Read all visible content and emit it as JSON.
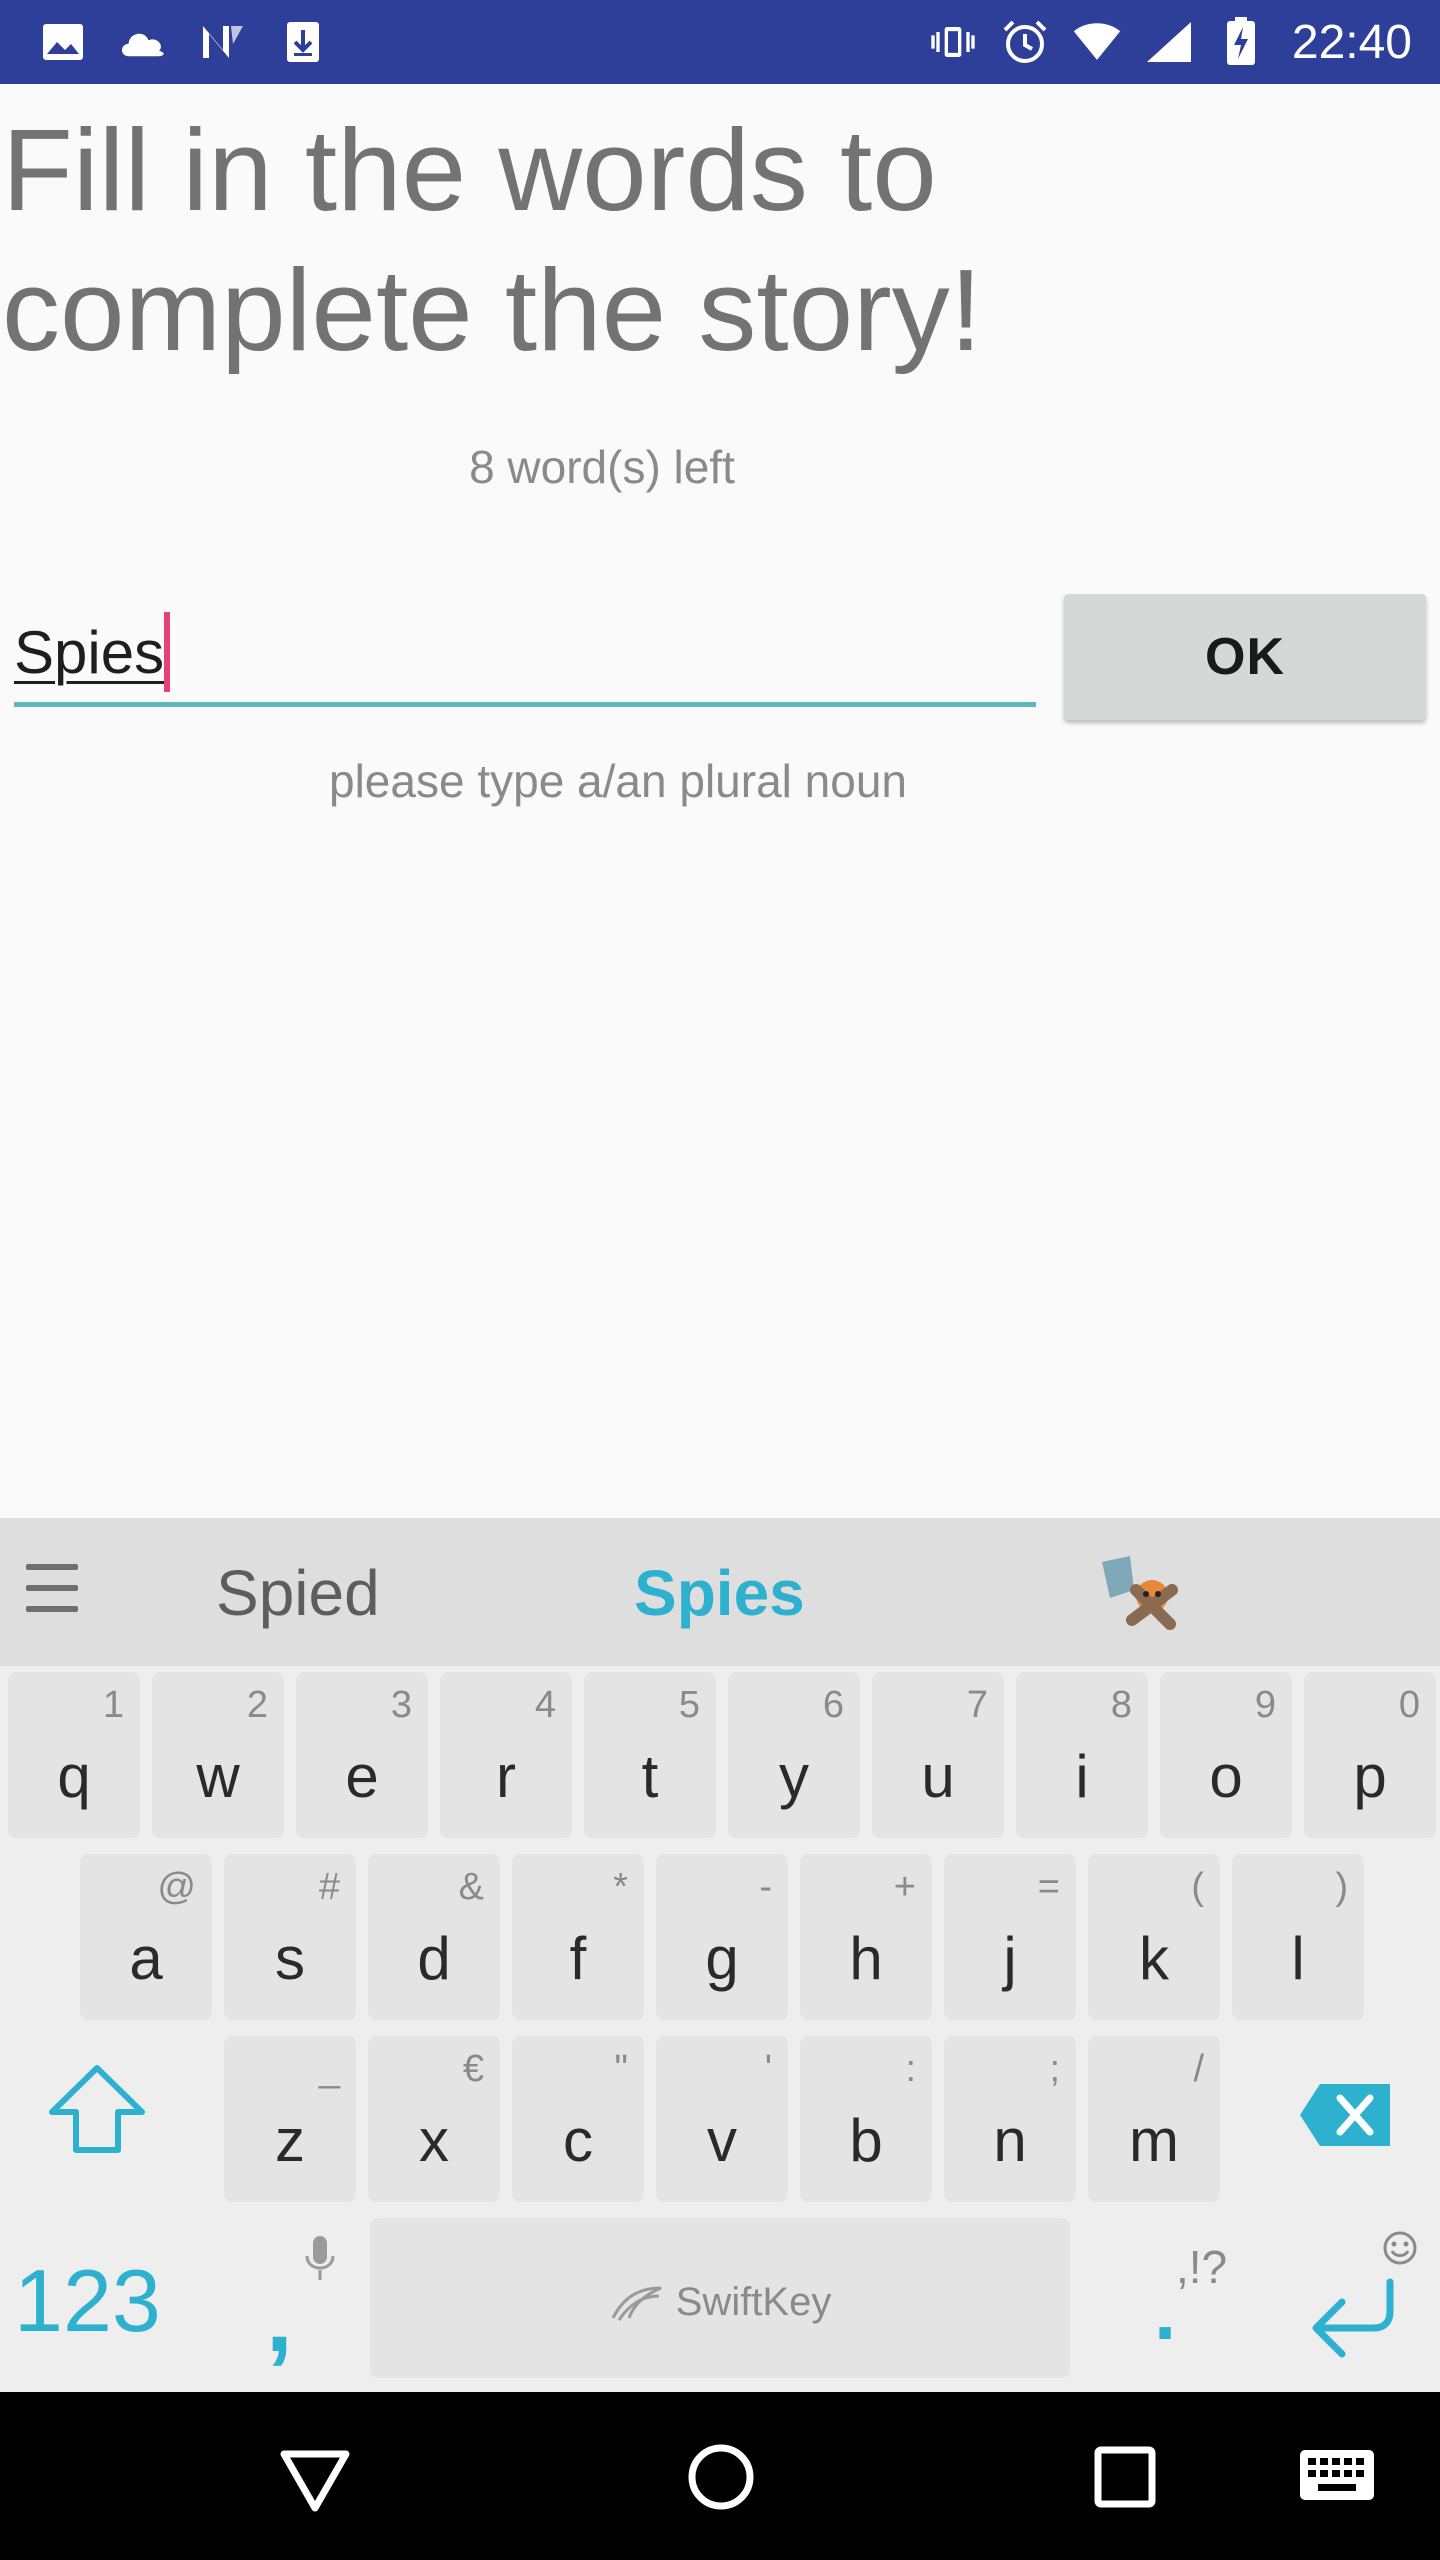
{
  "status_bar": {
    "time": "22:40",
    "left_icons": [
      "image-icon",
      "cloud-icon",
      "n-logo-icon",
      "download-icon"
    ],
    "right_icons": [
      "vibrate-icon",
      "alarm-icon",
      "wifi-icon",
      "signal-icon",
      "battery-charging-icon"
    ]
  },
  "app": {
    "title": "Fill in the words to complete the story!",
    "words_left": "8 word(s) left",
    "input_value": "Spies",
    "ok_label": "OK",
    "hint": "please type a/an plural noun"
  },
  "keyboard": {
    "suggestions": [
      "Spied",
      "Spies"
    ],
    "row1": [
      {
        "letter": "q",
        "hint": "1"
      },
      {
        "letter": "w",
        "hint": "2"
      },
      {
        "letter": "e",
        "hint": "3"
      },
      {
        "letter": "r",
        "hint": "4"
      },
      {
        "letter": "t",
        "hint": "5"
      },
      {
        "letter": "y",
        "hint": "6"
      },
      {
        "letter": "u",
        "hint": "7"
      },
      {
        "letter": "i",
        "hint": "8"
      },
      {
        "letter": "o",
        "hint": "9"
      },
      {
        "letter": "p",
        "hint": "0"
      }
    ],
    "row2": [
      {
        "letter": "a",
        "hint": "@"
      },
      {
        "letter": "s",
        "hint": "#"
      },
      {
        "letter": "d",
        "hint": "&"
      },
      {
        "letter": "f",
        "hint": "*"
      },
      {
        "letter": "g",
        "hint": "-"
      },
      {
        "letter": "h",
        "hint": "+"
      },
      {
        "letter": "j",
        "hint": "="
      },
      {
        "letter": "k",
        "hint": "("
      },
      {
        "letter": "l",
        "hint": ")"
      }
    ],
    "row3": [
      {
        "letter": "z",
        "hint": "_"
      },
      {
        "letter": "x",
        "hint": "€"
      },
      {
        "letter": "c",
        "hint": "\""
      },
      {
        "letter": "v",
        "hint": "'"
      },
      {
        "letter": "b",
        "hint": ":"
      },
      {
        "letter": "n",
        "hint": ";"
      },
      {
        "letter": "m",
        "hint": "/"
      }
    ],
    "numbers_label": "123",
    "comma": ",",
    "space_brand": "SwiftKey",
    "period": ".",
    "period_hint": ",!?",
    "accent_color": "#2eb0cf"
  },
  "colors": {
    "status_bar": "#2e3f9a",
    "cursor": "#e8407a",
    "input_underline": "#5db8c0"
  }
}
